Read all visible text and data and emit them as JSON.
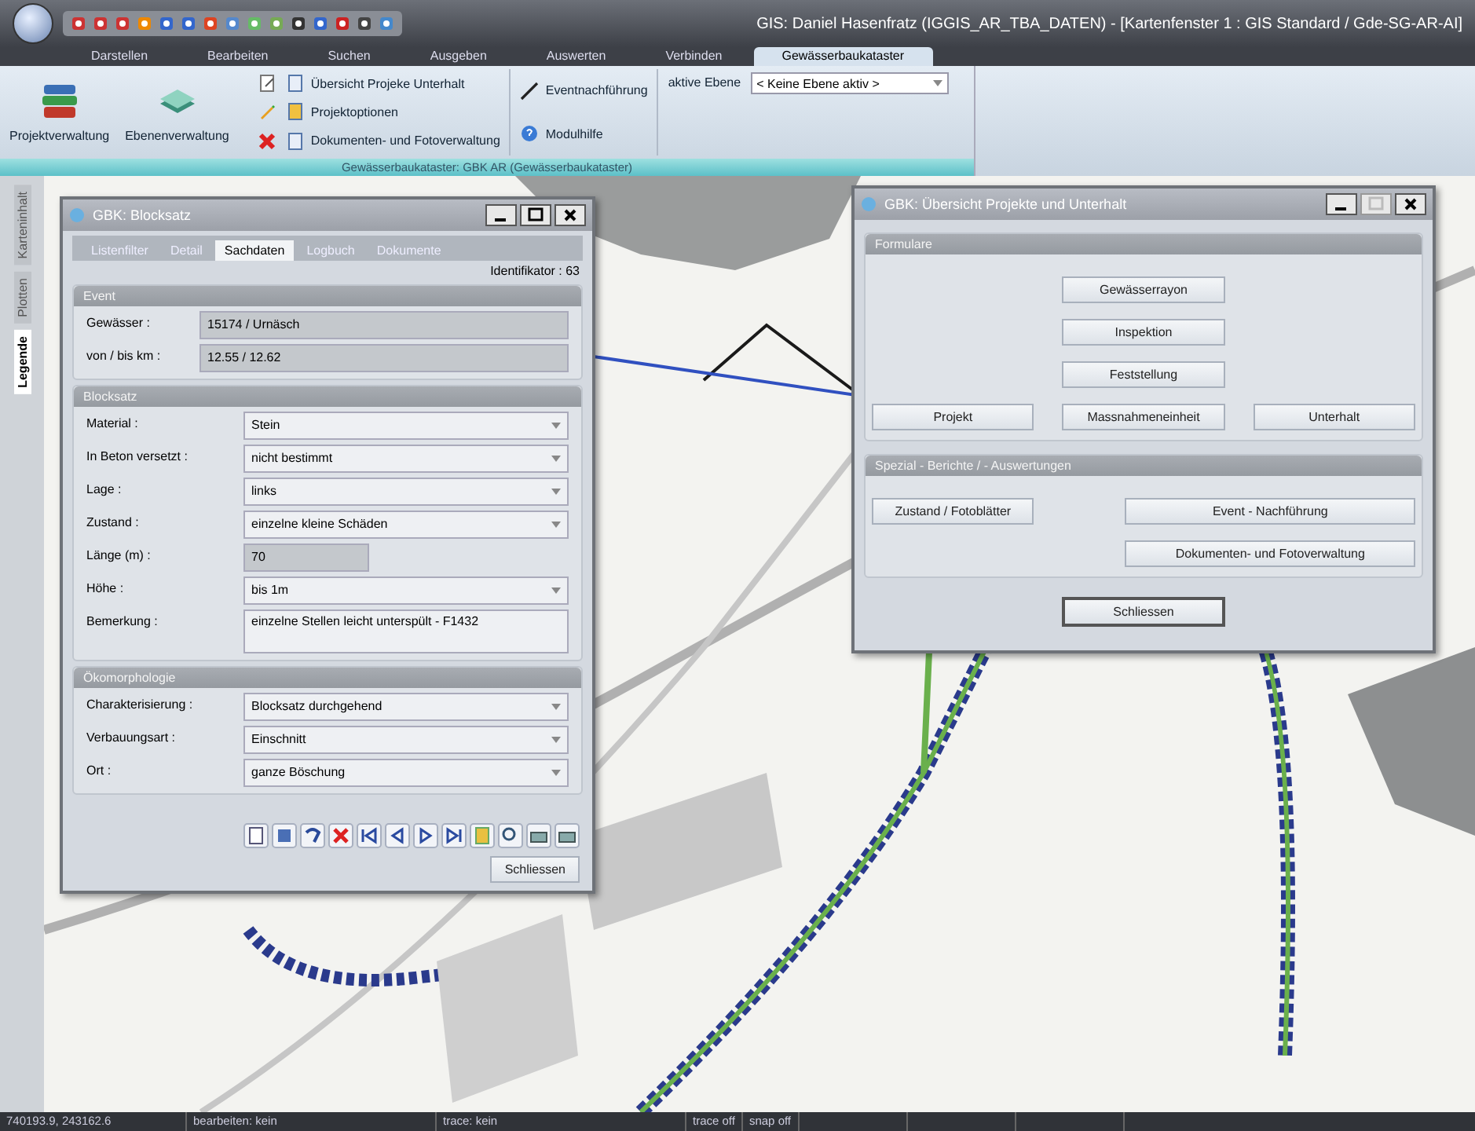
{
  "window": {
    "title": "GIS: Daniel Hasenfratz (IGGIS_AR_TBA_DATEN) - [Kartenfenster 1 : GIS Standard / Gde-SG-AR-AI]"
  },
  "ribbon_tabs": [
    {
      "label": "Darstellen",
      "selected": false
    },
    {
      "label": "Bearbeiten",
      "selected": false
    },
    {
      "label": "Suchen",
      "selected": false
    },
    {
      "label": "Ausgeben",
      "selected": false
    },
    {
      "label": "Auswerten",
      "selected": false
    },
    {
      "label": "Verbinden",
      "selected": false
    },
    {
      "label": "Gewässerbaukataster",
      "selected": true
    }
  ],
  "ribbon": {
    "large_buttons": [
      "Projektverwaltung",
      "Ebenenverwaltung"
    ],
    "commands": [
      "Übersicht Projeke Unterhalt",
      "Projektoptionen",
      "Dokumenten- und Fotoverwaltung"
    ],
    "commands_2": [
      "Eventnachführung",
      "Modulhilfe"
    ],
    "active_layer": {
      "label": "aktive Ebene",
      "value": "< Keine Ebene aktiv >"
    },
    "group_caption": "Gewässerbaukataster: GBK AR (Gewässerbaukataster)"
  },
  "side_tabs": [
    {
      "label": "Karteninhalt",
      "selected": false
    },
    {
      "label": "Plotten",
      "selected": false
    },
    {
      "label": "Legende",
      "selected": true
    }
  ],
  "map": {
    "kind": "picture"
  },
  "form_dialog": {
    "title": "GBK: Blocksatz",
    "tabs": [
      {
        "label": "Listenfilter",
        "selected": false
      },
      {
        "label": "Detail",
        "selected": false
      },
      {
        "label": "Sachdaten",
        "selected": true
      },
      {
        "label": "Logbuch",
        "selected": false
      },
      {
        "label": "Dokumente",
        "selected": false
      }
    ],
    "identifier": "Identifikator : 63",
    "groups": [
      {
        "title": "Event",
        "fields": [
          {
            "label": "Gewässer :",
            "value": "15174 / Urnäsch",
            "kind": "readonly"
          },
          {
            "label": "von / bis km :",
            "value": "12.55 / 12.62",
            "kind": "readonly"
          }
        ]
      },
      {
        "title": "Blocksatz",
        "fields": [
          {
            "label": "Material :",
            "value": "Stein",
            "kind": "select"
          },
          {
            "label": "In Beton versetzt :",
            "value": "nicht bestimmt",
            "kind": "select"
          },
          {
            "label": "Lage :",
            "value": "links",
            "kind": "select"
          },
          {
            "label": "Zustand :",
            "value": "einzelne kleine Schäden",
            "kind": "select"
          },
          {
            "label": "Länge (m) :",
            "value": "70",
            "kind": "short"
          },
          {
            "label": "Höhe :",
            "value": "bis 1m",
            "kind": "select"
          },
          {
            "label": "Bemerkung :",
            "value": "einzelne Stellen leicht unterspült - F1432",
            "kind": "memo"
          }
        ]
      },
      {
        "title": "Ökomorphologie",
        "fields": [
          {
            "label": "Charakterisierung :",
            "value": "Blocksatz durchgehend",
            "kind": "select"
          },
          {
            "label": "Verbauungsart :",
            "value": "Einschnitt",
            "kind": "select"
          },
          {
            "label": "Ort :",
            "value": "ganze Böschung",
            "kind": "select"
          }
        ]
      }
    ],
    "close_button": "Schliessen"
  },
  "overview_dialog": {
    "title": "GBK: Übersicht Projekte und Unterhalt",
    "groups": [
      {
        "title": "Formulare",
        "buttons": [
          "Gewässerrayon",
          "Inspektion",
          "Feststellung",
          "Projekt",
          "Massnahmeneinheit",
          "Unterhalt"
        ]
      },
      {
        "title": "Spezial - Berichte / - Auswertungen",
        "buttons": [
          "Zustand / Fotoblätter",
          "Event - Nachführung",
          "Dokumenten- und Fotoverwaltung"
        ]
      }
    ],
    "close_button": "Schliessen"
  },
  "status_bar": [
    "740193.9, 243162.6",
    "bearbeiten: kein",
    "trace: kein",
    "trace off",
    "snap off"
  ]
}
